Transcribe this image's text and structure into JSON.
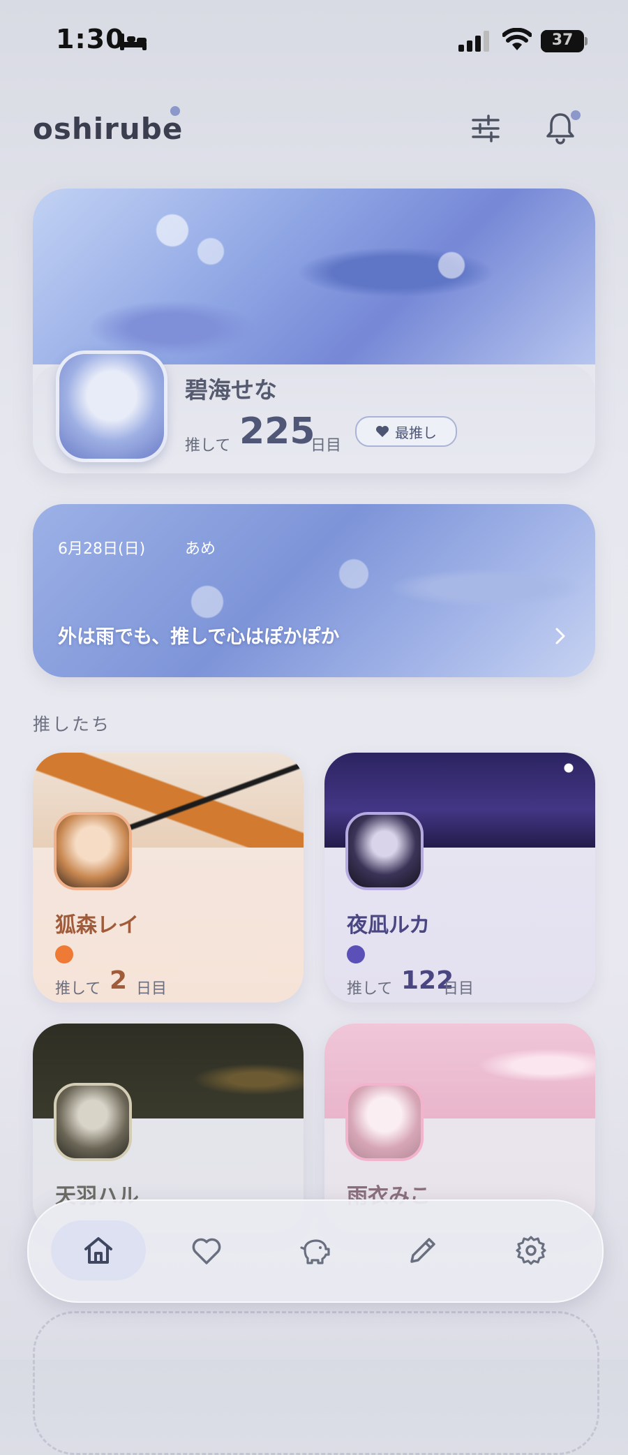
{
  "status_bar": {
    "time": "1:30",
    "battery": "37"
  },
  "header": {
    "logo": "oshirube"
  },
  "featured": {
    "name": "碧海せな",
    "label_prefix": "推して",
    "days": "225",
    "label_suffix": "日目",
    "badge": "最推し"
  },
  "message": {
    "date": "6月28日(日)",
    "weather": "あめ",
    "text": "外は雨でも、推しで心はぽかぽか"
  },
  "section_title": "推したち",
  "oshi_list": [
    {
      "name": "狐森レイ",
      "label_prefix": "推して",
      "days": "2",
      "label_suffix": "日目",
      "color": "#ee7a35"
    },
    {
      "name": "夜凪ルカ",
      "label_prefix": "推して",
      "days": "122",
      "label_suffix": "日目",
      "color": "#5b50b8"
    },
    {
      "name": "天羽ハル"
    },
    {
      "name": "雨衣みこ"
    }
  ],
  "nav": {
    "items": [
      "home-icon",
      "heart-icon",
      "piggy-bank-icon",
      "pencil-icon",
      "gear-icon"
    ],
    "active": "home-icon"
  },
  "colors": {
    "accent": "#4f5676",
    "nav_active_bg": "#dde1f1"
  }
}
